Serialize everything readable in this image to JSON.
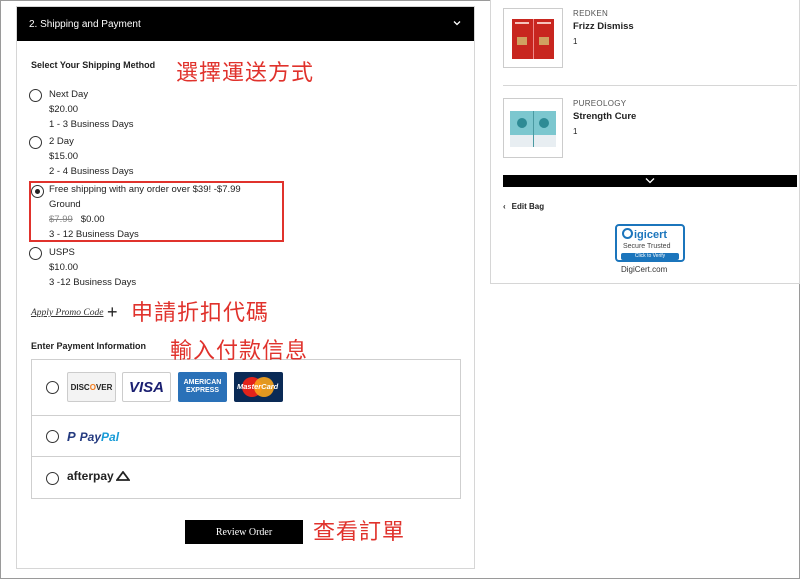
{
  "checkout": {
    "section_title": "2. Shipping and Payment",
    "shipping_heading": "Select Your Shipping Method",
    "shipping_options": [
      {
        "name": "Next Day",
        "price": "$20.00",
        "eta": "1 - 3 Business Days",
        "selected": false
      },
      {
        "name": "2 Day",
        "price": "$15.00",
        "eta": "2 - 4 Business Days",
        "selected": false
      },
      {
        "name": "Free shipping with any order over $39! -$7.99",
        "subname": "Ground",
        "old_price": "$7.99",
        "price": "$0.00",
        "eta": "3 - 12 Business Days",
        "selected": true
      },
      {
        "name": "USPS",
        "price": "$10.00",
        "eta": "3 -12 Business Days",
        "selected": false
      }
    ],
    "promo_link": "Apply Promo Code",
    "promo_plus": "+",
    "payment_heading": "Enter Payment Information",
    "payment_methods": {
      "cards": {
        "discover": "DISC",
        "discover_o": "O",
        "discover_tail": "VER",
        "visa": "VISA",
        "amex_line1": "AMERICAN",
        "amex_line2": "EXPRESS",
        "mastercard": "MasterCard"
      },
      "paypal": {
        "pay": "Pay",
        "pal": "Pal",
        "p": "P"
      },
      "afterpay": "afterpay"
    },
    "review_button": "Review Order"
  },
  "annotations": {
    "shipping": "選擇運送方式",
    "promo": "申請折扣代碼",
    "payment": "輸入付款信息",
    "review": "查看訂單"
  },
  "cart": {
    "items": [
      {
        "brand": "REDKEN",
        "name": "Frizz Dismiss",
        "qty": "1"
      },
      {
        "brand": "PUREOLOGY",
        "name": "Strength Cure",
        "qty": "1"
      }
    ],
    "edit_bag": "Edit Bag",
    "edit_arrow": "‹",
    "digicert": {
      "logo": "igicert",
      "sub": "Secure  Trusted",
      "verify": "Click to Verify",
      "domain": "DigiCert.com"
    }
  },
  "colors": {
    "accent_red": "#e0322c",
    "header_black": "#000000",
    "digicert_blue": "#1b75bc"
  }
}
